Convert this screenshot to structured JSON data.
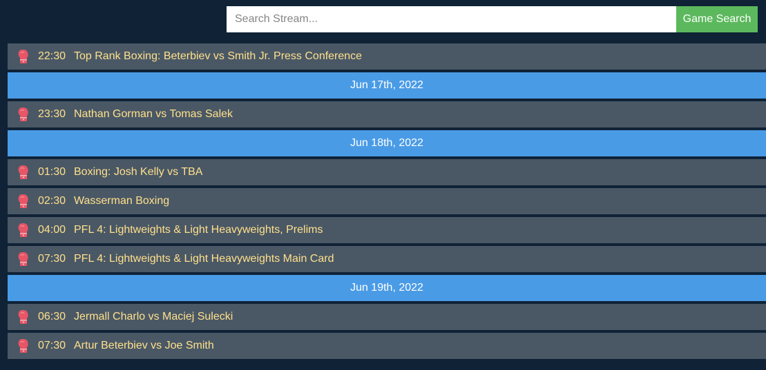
{
  "search": {
    "placeholder": "Search Stream...",
    "value": "",
    "button_label": "Game Search"
  },
  "icons": {
    "event_icon": "boxing-glove-icon"
  },
  "colors": {
    "background": "#0f2236",
    "event_row": "#4a5866",
    "date_row": "#4a9be6",
    "event_text": "#ffe08a",
    "search_button": "#5cb85c",
    "glove": "#e85566"
  },
  "schedule": [
    {
      "type": "event",
      "time": "22:30",
      "title": "Top Rank Boxing: Beterbiev vs Smith Jr. Press Conference"
    },
    {
      "type": "date",
      "label": "Jun 17th, 2022"
    },
    {
      "type": "event",
      "time": "23:30",
      "title": "Nathan Gorman vs Tomas Salek"
    },
    {
      "type": "date",
      "label": "Jun 18th, 2022"
    },
    {
      "type": "event",
      "time": "01:30",
      "title": "Boxing: Josh Kelly vs TBA"
    },
    {
      "type": "event",
      "time": "02:30",
      "title": "Wasserman Boxing"
    },
    {
      "type": "event",
      "time": "04:00",
      "title": "PFL 4: Lightweights & Light Heavyweights, Prelims"
    },
    {
      "type": "event",
      "time": "07:30",
      "title": "PFL 4: Lightweights & Light Heavyweights Main Card"
    },
    {
      "type": "date",
      "label": "Jun 19th, 2022"
    },
    {
      "type": "event",
      "time": "06:30",
      "title": "Jermall Charlo vs Maciej Sulecki"
    },
    {
      "type": "event",
      "time": "07:30",
      "title": "Artur Beterbiev vs Joe Smith"
    }
  ]
}
